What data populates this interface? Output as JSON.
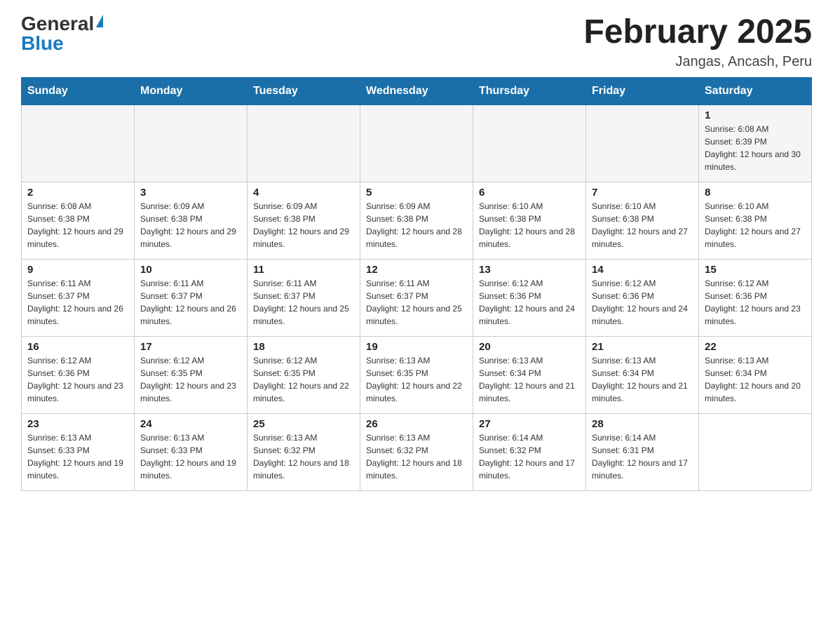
{
  "header": {
    "logo_general": "General",
    "logo_blue": "Blue",
    "title": "February 2025",
    "subtitle": "Jangas, Ancash, Peru"
  },
  "calendar": {
    "days_of_week": [
      "Sunday",
      "Monday",
      "Tuesday",
      "Wednesday",
      "Thursday",
      "Friday",
      "Saturday"
    ],
    "weeks": [
      [
        {
          "day": "",
          "info": ""
        },
        {
          "day": "",
          "info": ""
        },
        {
          "day": "",
          "info": ""
        },
        {
          "day": "",
          "info": ""
        },
        {
          "day": "",
          "info": ""
        },
        {
          "day": "",
          "info": ""
        },
        {
          "day": "1",
          "info": "Sunrise: 6:08 AM\nSunset: 6:39 PM\nDaylight: 12 hours and 30 minutes."
        }
      ],
      [
        {
          "day": "2",
          "info": "Sunrise: 6:08 AM\nSunset: 6:38 PM\nDaylight: 12 hours and 29 minutes."
        },
        {
          "day": "3",
          "info": "Sunrise: 6:09 AM\nSunset: 6:38 PM\nDaylight: 12 hours and 29 minutes."
        },
        {
          "day": "4",
          "info": "Sunrise: 6:09 AM\nSunset: 6:38 PM\nDaylight: 12 hours and 29 minutes."
        },
        {
          "day": "5",
          "info": "Sunrise: 6:09 AM\nSunset: 6:38 PM\nDaylight: 12 hours and 28 minutes."
        },
        {
          "day": "6",
          "info": "Sunrise: 6:10 AM\nSunset: 6:38 PM\nDaylight: 12 hours and 28 minutes."
        },
        {
          "day": "7",
          "info": "Sunrise: 6:10 AM\nSunset: 6:38 PM\nDaylight: 12 hours and 27 minutes."
        },
        {
          "day": "8",
          "info": "Sunrise: 6:10 AM\nSunset: 6:38 PM\nDaylight: 12 hours and 27 minutes."
        }
      ],
      [
        {
          "day": "9",
          "info": "Sunrise: 6:11 AM\nSunset: 6:37 PM\nDaylight: 12 hours and 26 minutes."
        },
        {
          "day": "10",
          "info": "Sunrise: 6:11 AM\nSunset: 6:37 PM\nDaylight: 12 hours and 26 minutes."
        },
        {
          "day": "11",
          "info": "Sunrise: 6:11 AM\nSunset: 6:37 PM\nDaylight: 12 hours and 25 minutes."
        },
        {
          "day": "12",
          "info": "Sunrise: 6:11 AM\nSunset: 6:37 PM\nDaylight: 12 hours and 25 minutes."
        },
        {
          "day": "13",
          "info": "Sunrise: 6:12 AM\nSunset: 6:36 PM\nDaylight: 12 hours and 24 minutes."
        },
        {
          "day": "14",
          "info": "Sunrise: 6:12 AM\nSunset: 6:36 PM\nDaylight: 12 hours and 24 minutes."
        },
        {
          "day": "15",
          "info": "Sunrise: 6:12 AM\nSunset: 6:36 PM\nDaylight: 12 hours and 23 minutes."
        }
      ],
      [
        {
          "day": "16",
          "info": "Sunrise: 6:12 AM\nSunset: 6:36 PM\nDaylight: 12 hours and 23 minutes."
        },
        {
          "day": "17",
          "info": "Sunrise: 6:12 AM\nSunset: 6:35 PM\nDaylight: 12 hours and 23 minutes."
        },
        {
          "day": "18",
          "info": "Sunrise: 6:12 AM\nSunset: 6:35 PM\nDaylight: 12 hours and 22 minutes."
        },
        {
          "day": "19",
          "info": "Sunrise: 6:13 AM\nSunset: 6:35 PM\nDaylight: 12 hours and 22 minutes."
        },
        {
          "day": "20",
          "info": "Sunrise: 6:13 AM\nSunset: 6:34 PM\nDaylight: 12 hours and 21 minutes."
        },
        {
          "day": "21",
          "info": "Sunrise: 6:13 AM\nSunset: 6:34 PM\nDaylight: 12 hours and 21 minutes."
        },
        {
          "day": "22",
          "info": "Sunrise: 6:13 AM\nSunset: 6:34 PM\nDaylight: 12 hours and 20 minutes."
        }
      ],
      [
        {
          "day": "23",
          "info": "Sunrise: 6:13 AM\nSunset: 6:33 PM\nDaylight: 12 hours and 19 minutes."
        },
        {
          "day": "24",
          "info": "Sunrise: 6:13 AM\nSunset: 6:33 PM\nDaylight: 12 hours and 19 minutes."
        },
        {
          "day": "25",
          "info": "Sunrise: 6:13 AM\nSunset: 6:32 PM\nDaylight: 12 hours and 18 minutes."
        },
        {
          "day": "26",
          "info": "Sunrise: 6:13 AM\nSunset: 6:32 PM\nDaylight: 12 hours and 18 minutes."
        },
        {
          "day": "27",
          "info": "Sunrise: 6:14 AM\nSunset: 6:32 PM\nDaylight: 12 hours and 17 minutes."
        },
        {
          "day": "28",
          "info": "Sunrise: 6:14 AM\nSunset: 6:31 PM\nDaylight: 12 hours and 17 minutes."
        },
        {
          "day": "",
          "info": ""
        }
      ]
    ]
  }
}
